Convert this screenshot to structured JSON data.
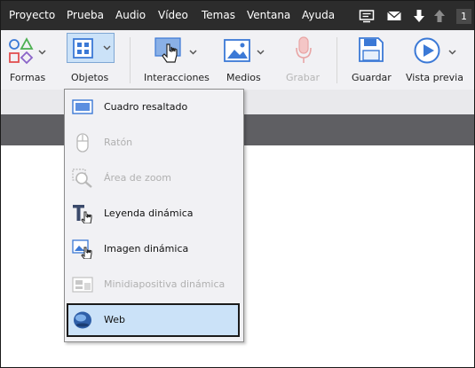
{
  "menubar": {
    "items": [
      "Proyecto",
      "Prueba",
      "Audio",
      "Vídeo",
      "Temas",
      "Ventana",
      "Ayuda"
    ],
    "badge": "1"
  },
  "ribbon": {
    "formas": "Formas",
    "objetos": "Objetos",
    "interacciones": "Interacciones",
    "medios": "Medios",
    "grabar": "Grabar",
    "guardar": "Guardar",
    "vista_previa": "Vista previa"
  },
  "dropdown": {
    "items": [
      {
        "label": "Cuadro resaltado",
        "enabled": true
      },
      {
        "label": "Ratón",
        "enabled": false
      },
      {
        "label": "Área de zoom",
        "enabled": false
      },
      {
        "label": "Leyenda dinámica",
        "enabled": true
      },
      {
        "label": "Imagen dinámica",
        "enabled": true
      },
      {
        "label": "Minidiapositiva dinámica",
        "enabled": false
      },
      {
        "label": "Web",
        "enabled": true,
        "selected": true
      }
    ]
  },
  "colors": {
    "menubar_bg": "#2c2c2c",
    "ribbon_bg": "#f1f1f4",
    "accent_blue": "#3b79d6",
    "selected_bg": "#cbe2f8"
  }
}
